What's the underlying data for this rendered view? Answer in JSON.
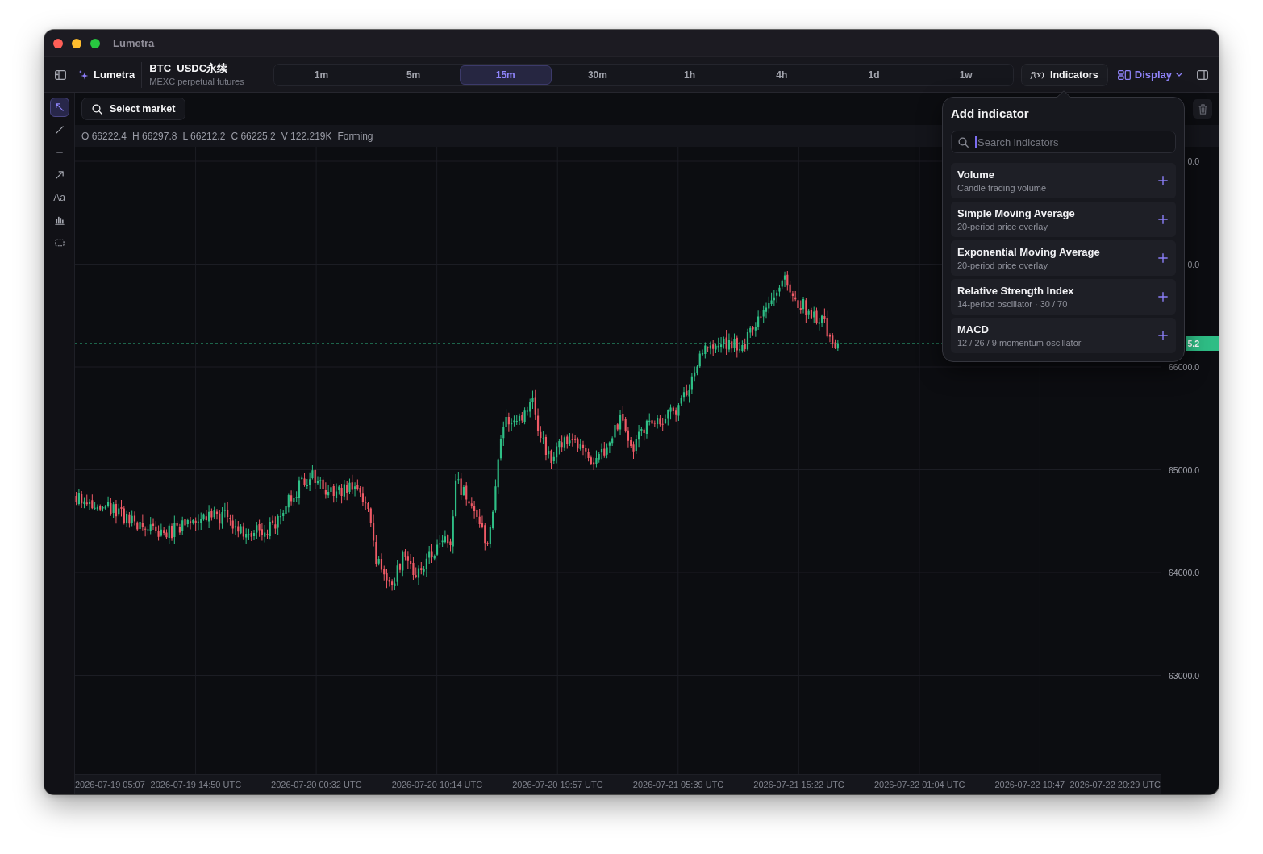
{
  "window": {
    "title": "Lumetra"
  },
  "toolbar": {
    "brand": "Lumetra",
    "market": {
      "symbol": "BTC_USDC永续",
      "subtitle": "MEXC perpetual futures"
    },
    "timeframes": [
      {
        "label": "1m",
        "selected": false
      },
      {
        "label": "5m",
        "selected": false
      },
      {
        "label": "15m",
        "selected": true
      },
      {
        "label": "30m",
        "selected": false
      },
      {
        "label": "1h",
        "selected": false
      },
      {
        "label": "4h",
        "selected": false
      },
      {
        "label": "1d",
        "selected": false
      },
      {
        "label": "1w",
        "selected": false
      }
    ],
    "indicators_button": {
      "icon_text": "*f*(x)",
      "label": "Indicators"
    },
    "display_button": {
      "label": "Display"
    }
  },
  "drawing_tools": [
    {
      "selected": true
    },
    {
      "selected": false
    },
    {
      "selected": false
    },
    {
      "selected": false
    },
    {
      "label": "Aa",
      "selected": false
    },
    {
      "selected": false
    },
    {
      "selected": false
    }
  ],
  "chart": {
    "market_button": {
      "label": "Select market"
    },
    "ohlc": [
      "O 66222.4",
      "H 66297.8",
      "L 66212.2",
      "C 66225.2",
      "V 122.219K"
    ],
    "candle_state": "Forming",
    "price_labels": [
      "0.0",
      "0.0",
      "66000.0",
      "65000.0",
      "64000.0",
      "63000.0"
    ],
    "last_price_tag": "5.2",
    "time_labels": [
      "2026-07-19 05:07",
      "2026-07-19 14:50 UTC",
      "2026-07-20 00:32 UTC",
      "2026-07-20 10:14 UTC",
      "2026-07-20 19:57 UTC",
      "2026-07-21 05:39 UTC",
      "2026-07-21 15:22 UTC",
      "2026-07-22 01:04 UTC",
      "2026-07-22 10:47",
      "2026-07-22 20:29 UTC"
    ]
  },
  "indicator_popup": {
    "title": "Add indicator",
    "search": {
      "placeholder": "Search indicators",
      "focused": true
    },
    "items": [
      {
        "name": "Volume",
        "description": "Candle trading volume"
      },
      {
        "name": "Simple Moving Average",
        "description": "20-period price overlay"
      },
      {
        "name": "Exponential Moving Average",
        "description": "20-period price overlay"
      },
      {
        "name": "Relative Strength Index",
        "description": "14-period oscillator · 30 / 70"
      },
      {
        "name": "MACD",
        "description": "12 / 26 / 9 momentum oscillator"
      }
    ]
  }
}
